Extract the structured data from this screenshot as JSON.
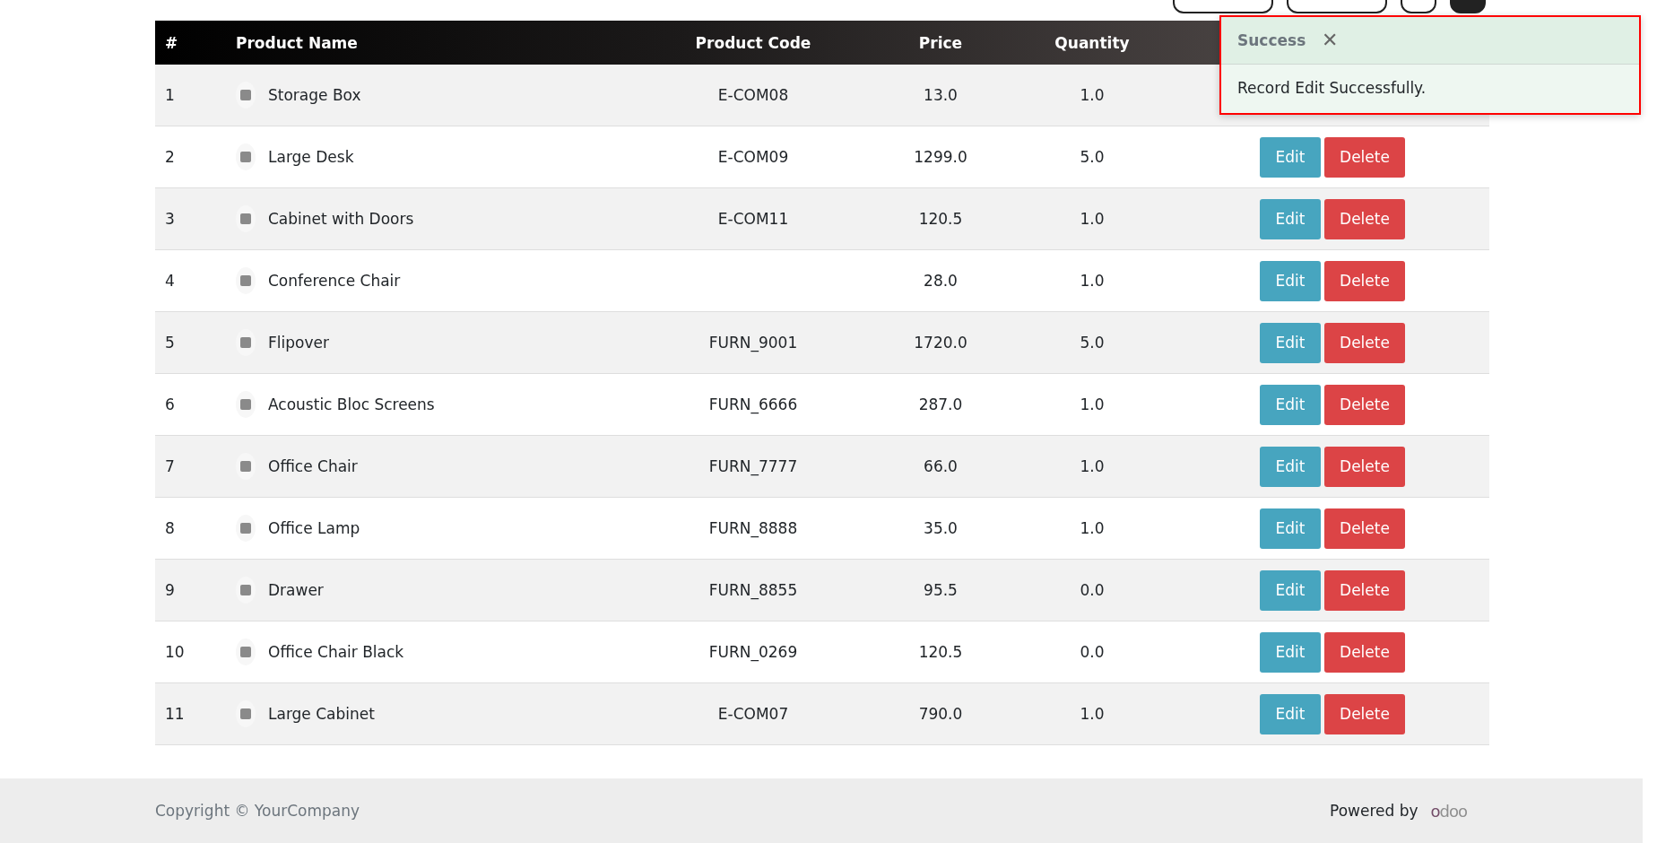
{
  "top_buttons": [
    {
      "kind": "wide"
    },
    {
      "kind": "wide"
    },
    {
      "kind": "square"
    },
    {
      "kind": "dark"
    }
  ],
  "table": {
    "columns": [
      "#",
      "Product Name",
      "Product Code",
      "Price",
      "Quantity"
    ],
    "rows": [
      {
        "index": "1",
        "name": "Storage Box",
        "code": "E-COM08",
        "price": "13.0",
        "quantity": "1.0"
      },
      {
        "index": "2",
        "name": "Large Desk",
        "code": "E-COM09",
        "price": "1299.0",
        "quantity": "5.0",
        "actions": [
          "Edit",
          "Delete"
        ]
      },
      {
        "index": "3",
        "name": "Cabinet with Doors",
        "code": "E-COM11",
        "price": "120.5",
        "quantity": "1.0",
        "actions": [
          "Edit",
          "Delete"
        ]
      },
      {
        "index": "4",
        "name": "Conference Chair",
        "price": "28.0",
        "quantity": "1.0",
        "actions": [
          "Edit",
          "Delete"
        ]
      },
      {
        "index": "5",
        "name": "Flipover",
        "code": "FURN_9001",
        "price": "1720.0",
        "quantity": "5.0",
        "actions": [
          "Edit",
          "Delete"
        ]
      },
      {
        "index": "6",
        "name": "Acoustic Bloc Screens",
        "code": "FURN_6666",
        "price": "287.0",
        "quantity": "1.0",
        "actions": [
          "Edit",
          "Delete"
        ]
      },
      {
        "index": "7",
        "name": "Office Chair",
        "code": "FURN_7777",
        "price": "66.0",
        "quantity": "1.0",
        "actions": [
          "Edit",
          "Delete"
        ]
      },
      {
        "index": "8",
        "name": "Office Lamp",
        "code": "FURN_8888",
        "price": "35.0",
        "quantity": "1.0",
        "actions": [
          "Edit",
          "Delete"
        ]
      },
      {
        "index": "9",
        "name": "Drawer",
        "code": "FURN_8855",
        "price": "95.5",
        "quantity": "0.0",
        "actions": [
          "Edit",
          "Delete"
        ]
      },
      {
        "index": "10",
        "name": "Office Chair Black",
        "code": "FURN_0269",
        "price": "120.5",
        "quantity": "0.0",
        "actions": [
          "Edit",
          "Delete"
        ]
      },
      {
        "index": "11",
        "name": "Large Cabinet",
        "code": "E-COM07",
        "price": "790.0",
        "quantity": "1.0",
        "actions": [
          "Edit",
          "Delete"
        ]
      }
    ]
  },
  "toast": {
    "title": "Success",
    "close": "✕",
    "message": "Record Edit Successfully."
  },
  "footer": {
    "copyright": "Copyright © YourCompany",
    "powered_by": "Powered by",
    "logo": "odoo"
  }
}
